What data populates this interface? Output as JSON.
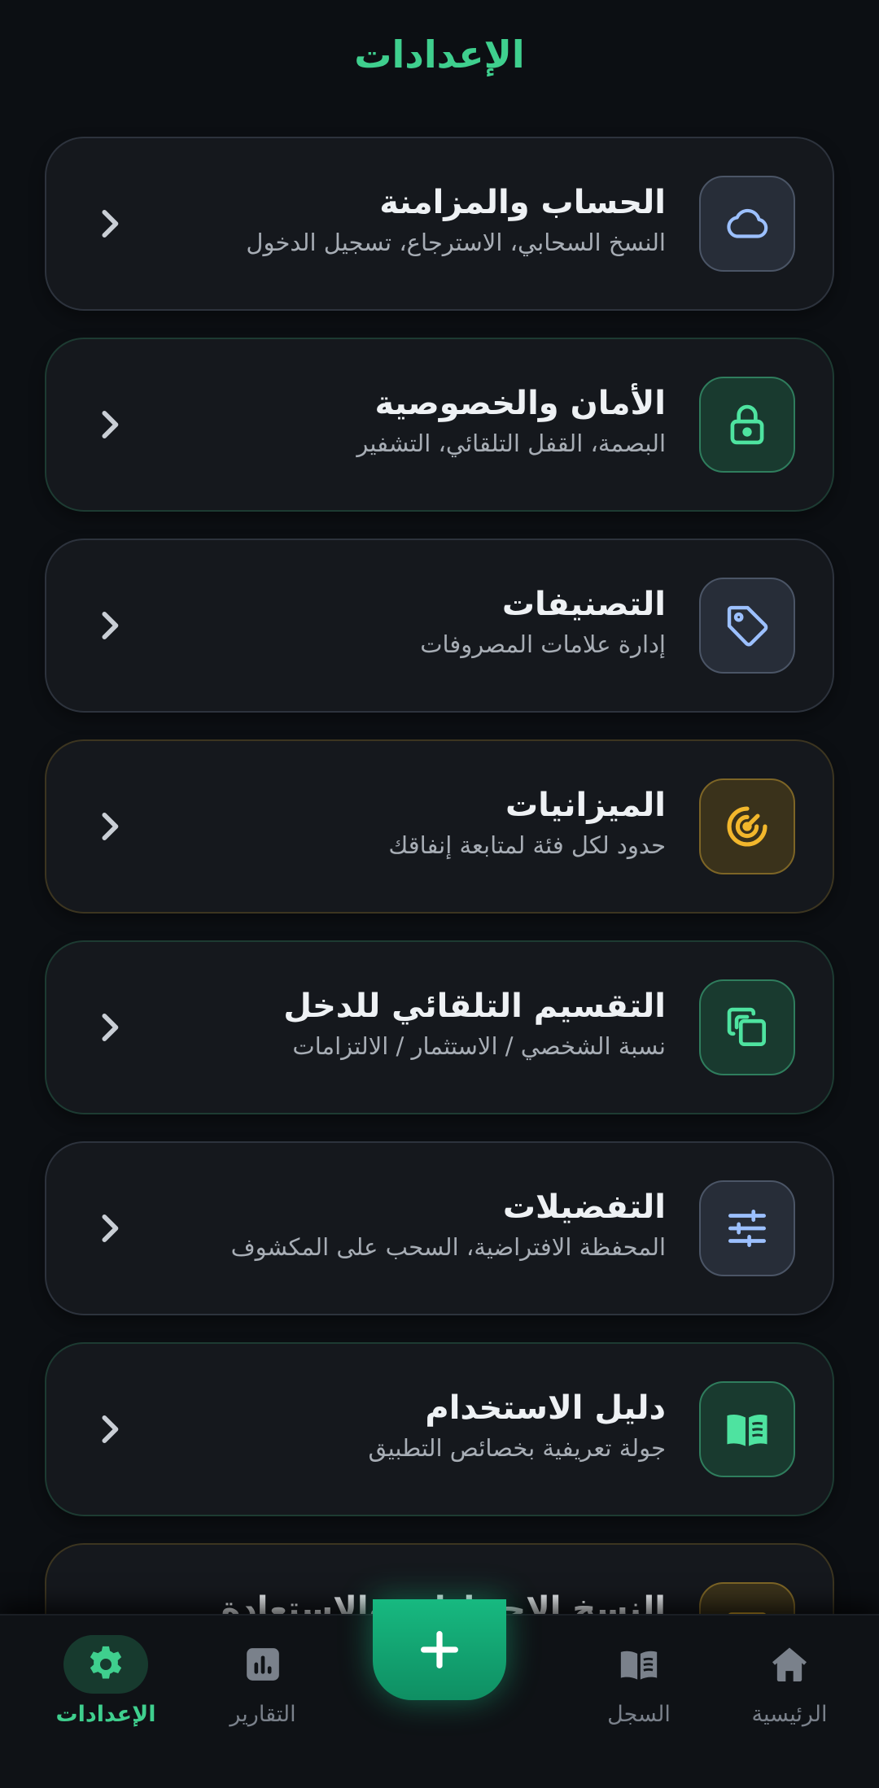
{
  "header": {
    "title": "الإعدادات"
  },
  "settings": [
    {
      "title": "الحساب والمزامنة",
      "subtitle": "النسخ السحابي، الاسترجاع، تسجيل الدخول",
      "icon": "cloud-icon",
      "tone": "slate"
    },
    {
      "title": "الأمان والخصوصية",
      "subtitle": "البصمة، القفل التلقائي، التشفير",
      "icon": "lock-icon",
      "tone": "green"
    },
    {
      "title": "التصنيفات",
      "subtitle": "إدارة علامات المصروفات",
      "icon": "tag-icon",
      "tone": "slate"
    },
    {
      "title": "الميزانيات",
      "subtitle": "حدود لكل فئة لمتابعة إنفاقك",
      "icon": "target-icon",
      "tone": "gold"
    },
    {
      "title": "التقسيم التلقائي للدخل",
      "subtitle": "نسبة الشخصي / الاستثمار / الالتزامات",
      "icon": "copy-icon",
      "tone": "green"
    },
    {
      "title": "التفضيلات",
      "subtitle": "المحفظة الافتراضية، السحب على المكشوف",
      "icon": "sliders-icon",
      "tone": "slate"
    },
    {
      "title": "دليل الاستخدام",
      "subtitle": "جولة تعريفية بخصائص التطبيق",
      "icon": "book-icon",
      "tone": "green"
    },
    {
      "title": "النسخ الاحتياطي والاستعادة",
      "subtitle": "",
      "icon": "archive-icon",
      "tone": "gold"
    }
  ],
  "nav": {
    "home": "الرئيسية",
    "log": "السجل",
    "add_icon": "plus-icon",
    "reports": "التقارير",
    "settings": "الإعدادات"
  },
  "colors": {
    "accent": "#3fcf8e",
    "background": "#0c0f13",
    "card": "#15181d",
    "gold": "#f2b72c",
    "slate_icon": "#9cc0ff"
  }
}
